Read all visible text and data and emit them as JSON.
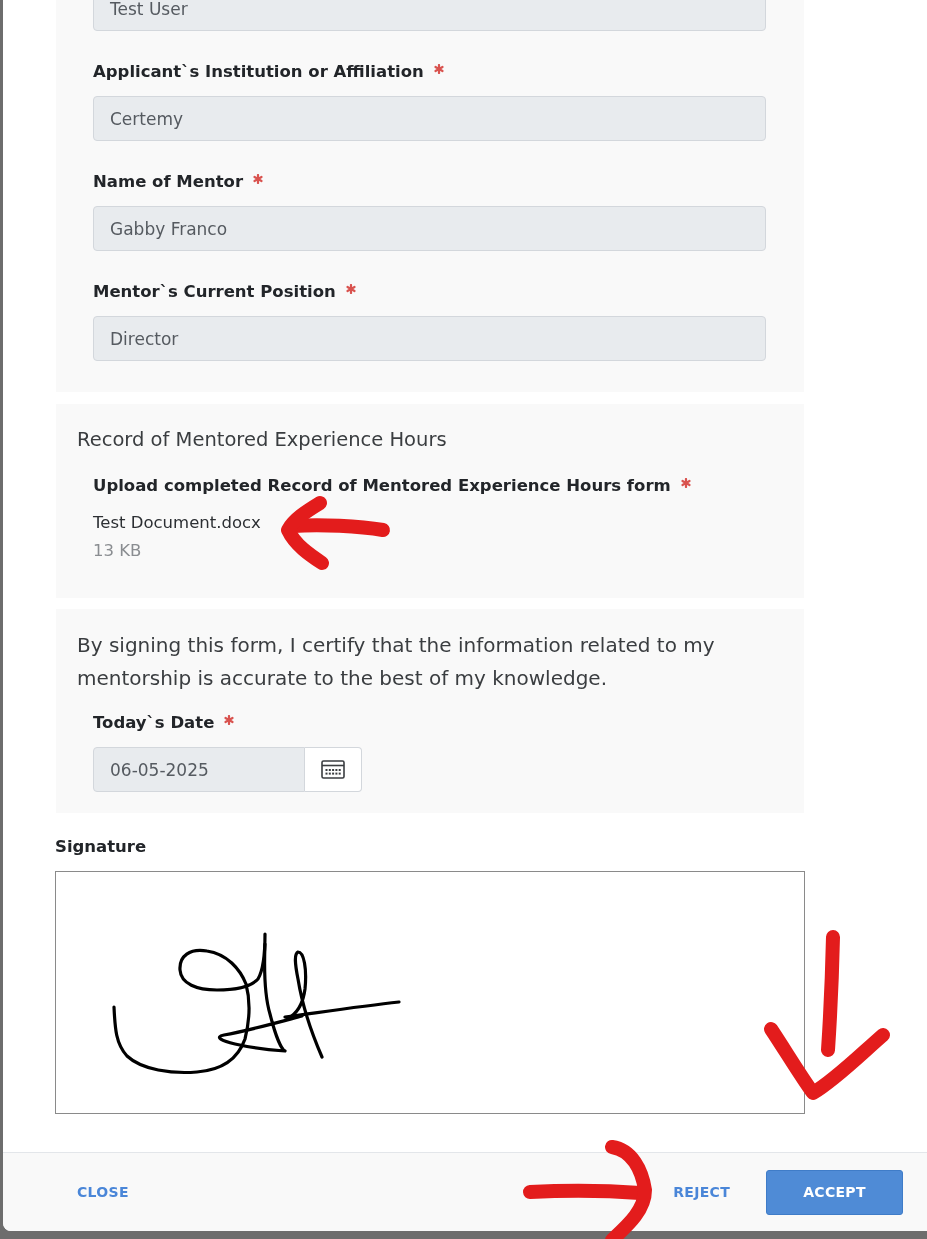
{
  "personal_section": {
    "fields": [
      {
        "value": "Test User",
        "disabled": true
      },
      {
        "label": "Applicant`s Institution or Affiliation",
        "required": true,
        "value": "Certemy",
        "disabled": true
      },
      {
        "label": "Name of Mentor",
        "required": true,
        "value": "Gabby Franco",
        "disabled": true
      },
      {
        "label": "Mentor`s Current Position",
        "required": true,
        "value": "Director",
        "disabled": true
      }
    ]
  },
  "mentored_hours_section": {
    "title": "Record of Mentored Experience Hours",
    "upload": {
      "label": "Upload completed Record of Mentored Experience Hours form",
      "required": true,
      "file_name": "Test Document.docx",
      "file_size": "13 KB"
    }
  },
  "certification_section": {
    "statement": "By signing this form, I certify that the information related to my mentorship is accurate to the best of my knowledge.",
    "date_field": {
      "label": "Today`s Date",
      "required": true,
      "value": "06-05-2025",
      "disabled": true
    }
  },
  "signature": {
    "label": "Signature"
  },
  "footer": {
    "left_buttons": [
      {
        "label": "CLOSE",
        "kind": "text"
      }
    ],
    "right_buttons": [
      {
        "label": "REJECT",
        "kind": "text"
      },
      {
        "label": "ACCEPT",
        "kind": "primary"
      }
    ]
  }
}
